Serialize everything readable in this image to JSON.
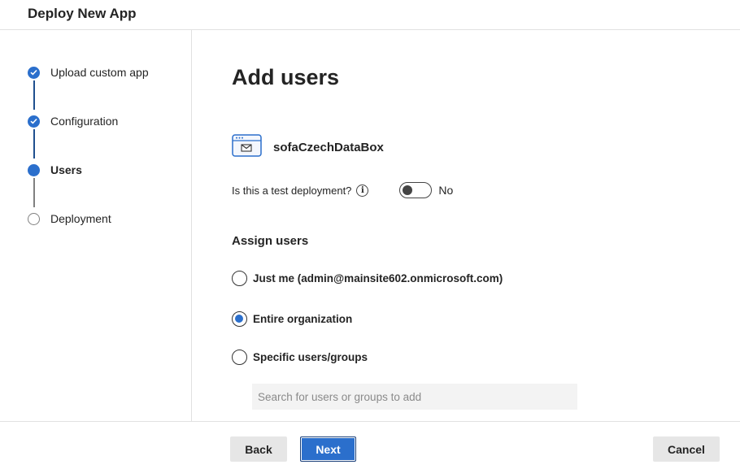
{
  "header": {
    "title": "Deploy New App"
  },
  "steps": [
    {
      "label": "Upload custom app",
      "state": "done"
    },
    {
      "label": "Configuration",
      "state": "done"
    },
    {
      "label": "Users",
      "state": "current"
    },
    {
      "label": "Deployment",
      "state": "pending"
    }
  ],
  "main": {
    "title": "Add users",
    "app_name": "sofaCzechDataBox",
    "test_deployment": {
      "label": "Is this a test deployment?",
      "info_icon": "info-icon",
      "toggle_on": false,
      "toggle_text": "No"
    },
    "assign_users": {
      "title": "Assign users",
      "options": [
        {
          "label": "Just me (admin@mainsite602.onmicrosoft.com)",
          "checked": false
        },
        {
          "label": "Entire organization",
          "checked": true
        },
        {
          "label": "Specific users/groups",
          "checked": false
        }
      ],
      "search": {
        "placeholder": "Search for users or groups to add",
        "value": ""
      }
    }
  },
  "footer": {
    "back_label": "Back",
    "next_label": "Next",
    "cancel_label": "Cancel"
  },
  "colors": {
    "accent": "#2b6fcc",
    "connector_done": "#1f4f8f",
    "connector_pending": "#808080",
    "button_gray": "#e6e6e6"
  }
}
